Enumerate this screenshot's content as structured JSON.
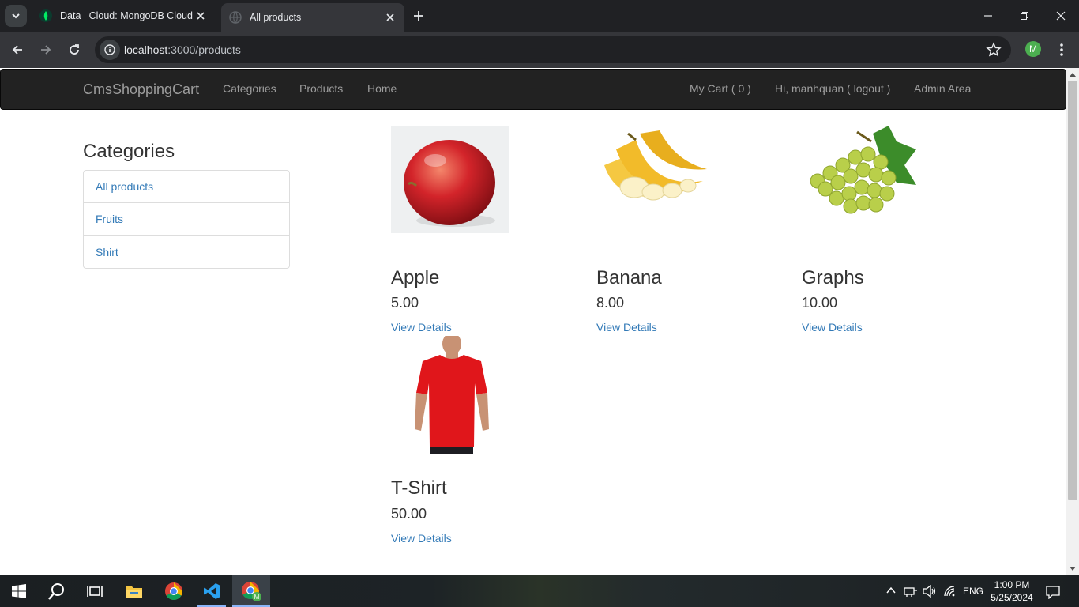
{
  "browser": {
    "tabs": [
      {
        "title": "Data | Cloud: MongoDB Cloud",
        "active": false,
        "favicon": "mongodb-leaf-icon"
      },
      {
        "title": "All products",
        "active": true,
        "favicon": "globe-icon"
      }
    ],
    "url": {
      "host": "localhost",
      "path": ":3000/products"
    },
    "profile_initial": "M"
  },
  "navbar": {
    "brand": "CmsShoppingCart",
    "left_links": [
      "Categories",
      "Products",
      "Home"
    ],
    "cart": "My Cart ( 0 )",
    "user": "Hi, manhquan ( logout )",
    "admin": "Admin Area"
  },
  "sidebar": {
    "heading": "Categories",
    "items": [
      "All products",
      "Fruits",
      "Shirt"
    ]
  },
  "products": [
    {
      "name": "Apple",
      "price": "5.00",
      "link": "View Details",
      "image": "apple"
    },
    {
      "name": "Banana",
      "price": "8.00",
      "link": "View Details",
      "image": "banana"
    },
    {
      "name": "Graphs",
      "price": "10.00",
      "link": "View Details",
      "image": "grapes"
    },
    {
      "name": "T-Shirt",
      "price": "50.00",
      "link": "View Details",
      "image": "red-tshirt"
    }
  ],
  "taskbar": {
    "language": "ENG",
    "time": "1:00 PM",
    "date": "5/25/2024"
  },
  "colors": {
    "navbar_bg": "#222222",
    "link": "#337ab7",
    "muted_nav_text": "#9d9d9d"
  }
}
